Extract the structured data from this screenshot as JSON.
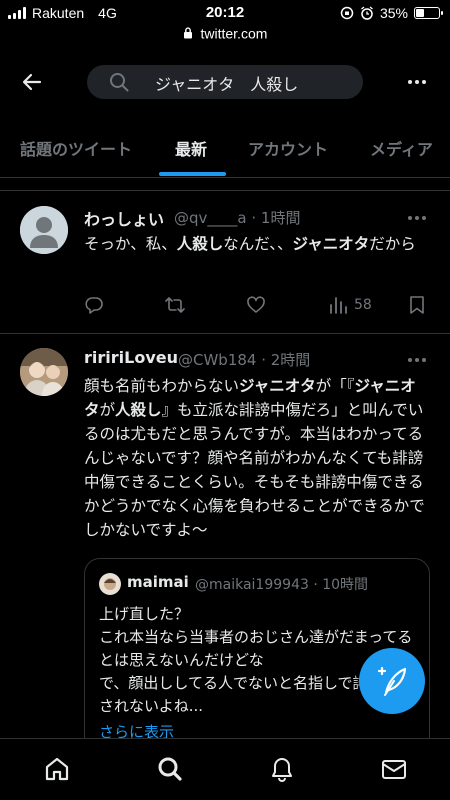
{
  "status": {
    "carrier": "Rakuten",
    "network": "4G",
    "time": "20:12",
    "battery": "35%",
    "battery_level": 0.35
  },
  "browser": {
    "url": "twitter.com"
  },
  "header": {
    "search_query": "ジャニオタ　人殺し"
  },
  "tabs": [
    {
      "label": "話題のツイート"
    },
    {
      "label": "最新"
    },
    {
      "label": "アカウント"
    },
    {
      "label": "メディア"
    }
  ],
  "tweets": [
    {
      "name": "わっしょい",
      "handle": "@qv____a · 1時間",
      "text_parts": [
        "そっか、私、",
        "人殺し",
        "なんだ、、",
        "ジャニオタ",
        "だから"
      ],
      "actions": {
        "views": "58"
      }
    },
    {
      "name": "riririLoveu",
      "handle": "@CWb184 · 2時間",
      "text_parts": [
        "顔も名前もわからない",
        "ジャニオタ",
        "が「『",
        "ジャニオタ",
        "が",
        "人殺し",
        "』も立派な誹謗中傷だろ」と叫んでいるのは尤もだと思うんですが。本当はわかってるんじゃないです？顔や名前がわかんなくても誹謗中傷できることくらい。そもそも誹謗中傷できるかどうかでなく心傷を負わせることができるかでしかないですよ〜"
      ],
      "quote": {
        "name": "maimai",
        "handle": "@maikai199943 · 10時間",
        "text": "上げ直した？\nこれ本当なら当事者のおじさん達がだまってるとは思えないんだけどな\nで、顔出ししてる人でないと名指しで誹謗中傷されないよね...",
        "more_label": "さらに表示"
      }
    }
  ],
  "colors": {
    "accent": "#1d9bf0",
    "background": "#000000",
    "text": "#e7e9ea",
    "muted": "#71767b",
    "border": "#2f3336"
  }
}
